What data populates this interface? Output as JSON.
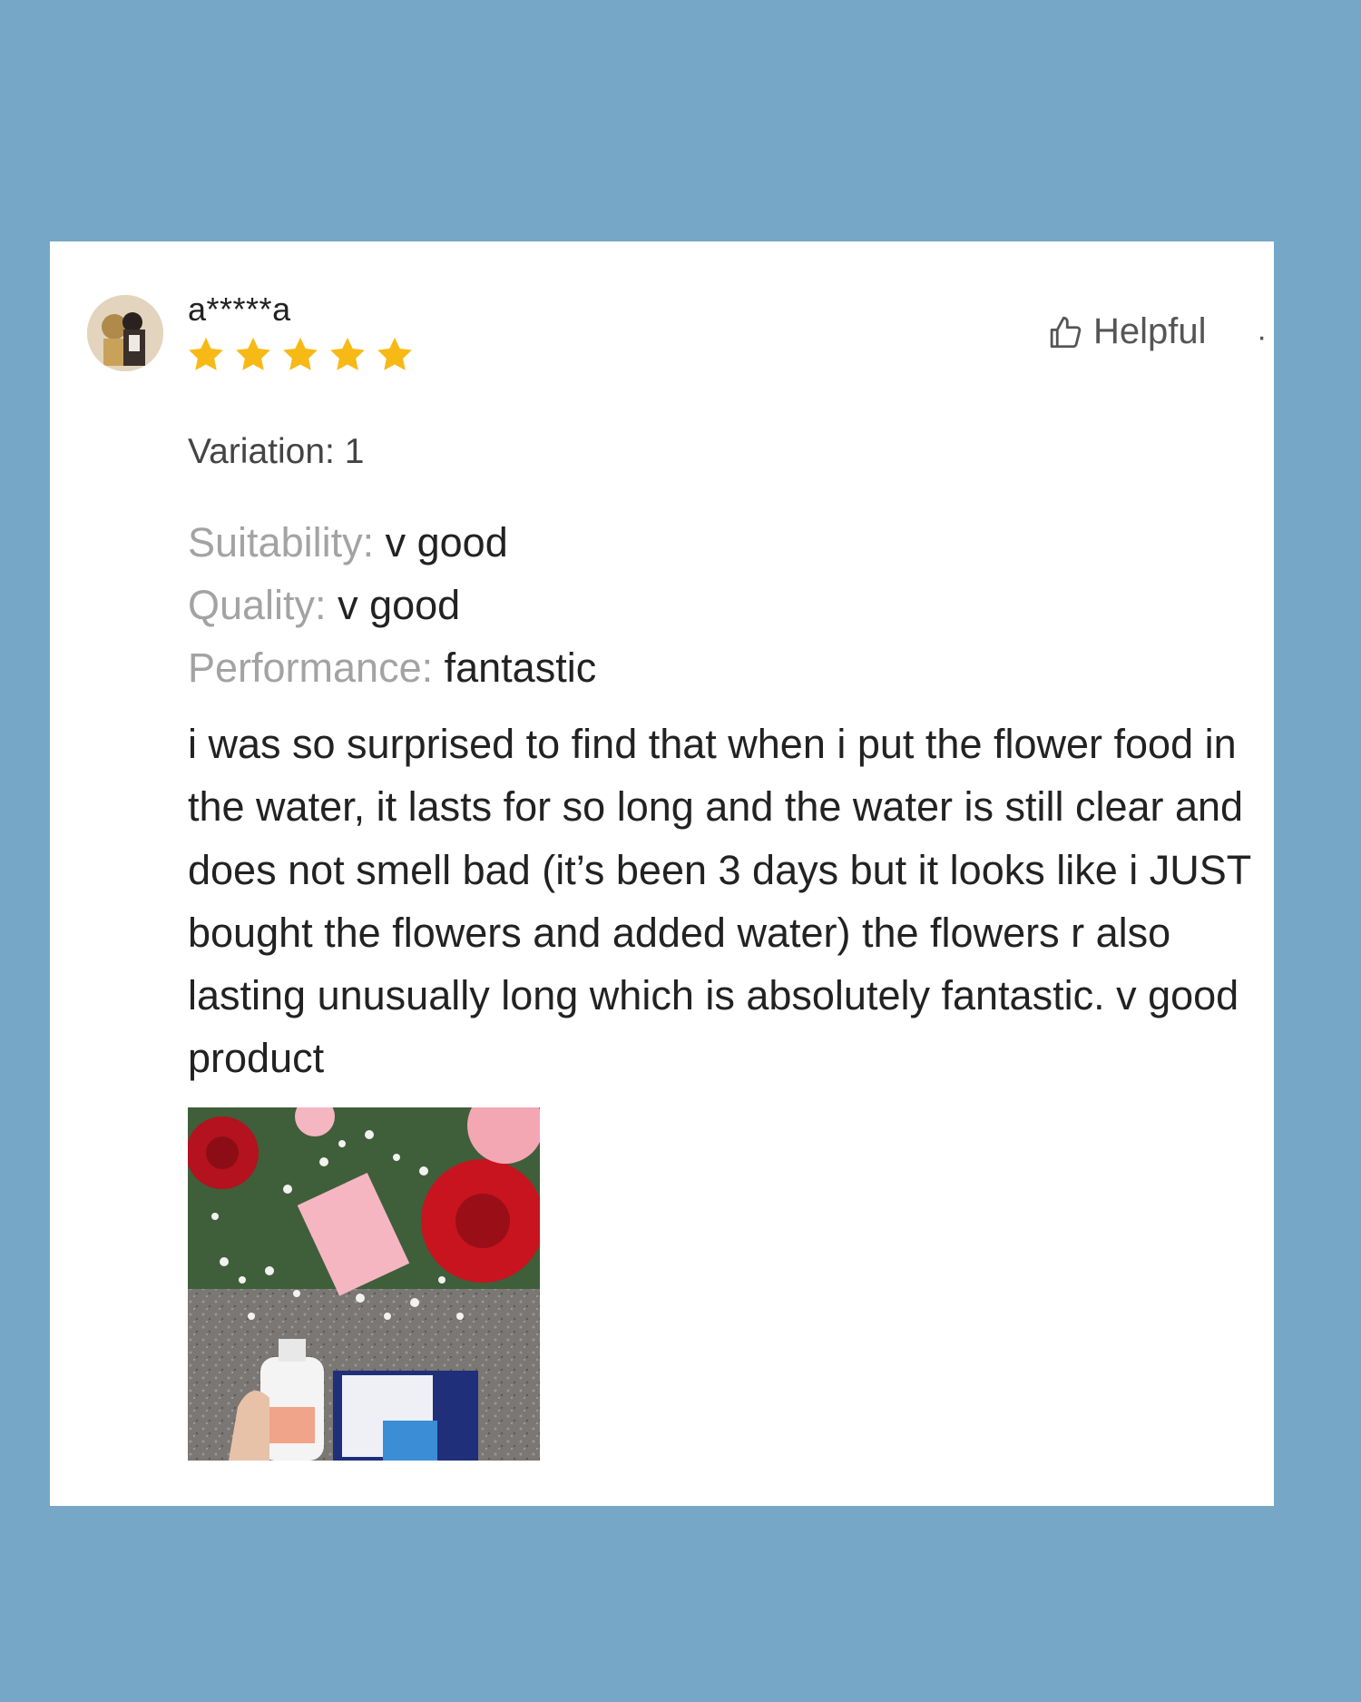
{
  "review": {
    "username": "a*****a",
    "rating": 5,
    "rating_max": 5,
    "helpful_label": "Helpful",
    "more_label": "·",
    "variation": "Variation: 1",
    "attributes": [
      {
        "label": "Suitability: ",
        "value": "v good"
      },
      {
        "label": "Quality: ",
        "value": "v good"
      },
      {
        "label": "Performance: ",
        "value": "fantastic"
      }
    ],
    "text": "i was so surprised to find that when i put the flower food in the water, it lasts for so long and the water is still clear and does not smell bad (it’s been 3 days but it looks like i JUST bought the flowers and added water) the flowers r also lasting unusually long which is absolutely fantastic. v good product",
    "icons": {
      "avatar": "user-avatar-icon",
      "star": "star-icon",
      "helpful": "thumbs-up-icon"
    }
  },
  "colors": {
    "background": "#76a7c7",
    "card": "#ffffff",
    "star": "#f7b916",
    "label_gray": "#a3a3a3",
    "text": "#222222"
  }
}
